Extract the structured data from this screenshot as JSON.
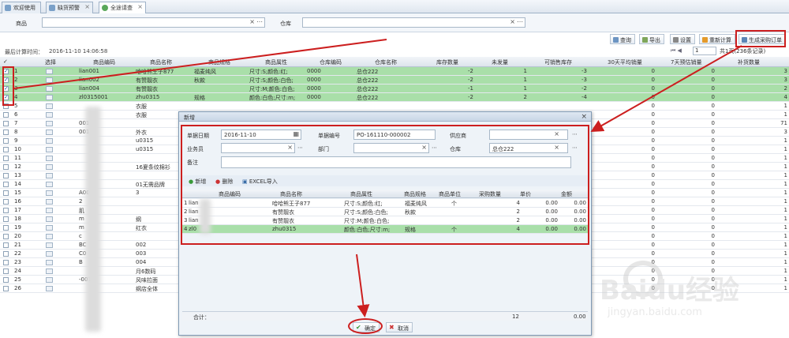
{
  "tabs": [
    {
      "label": "欢迎使用"
    },
    {
      "label": "缺货预警"
    },
    {
      "label": "全途请查"
    }
  ],
  "filter": {
    "product_label": "商品",
    "warehouse_label": "仓库"
  },
  "toolbar": {
    "query": "查询",
    "export": "导出",
    "settings": "设置",
    "refresh": "重新计算",
    "generate": "生成采购订单"
  },
  "calc_time": {
    "label": "最后计算时间：",
    "value": "2016-11-10 14:06:58"
  },
  "pagination": {
    "page": "1",
    "info": "共1页(236条记录)"
  },
  "columns": [
    "选择",
    "商品编码",
    "商品名称",
    "商品规格",
    "商品属性",
    "仓库编码",
    "仓库名称",
    "库存数量",
    "未发量",
    "可销售库存",
    "30天平均销量",
    "7天预估销量",
    "补货数量"
  ],
  "rows": [
    {
      "n": "1",
      "checked": true,
      "sel": true,
      "code": "lian001",
      "name": "哈哈熊王子877",
      "spec": "福麦纯风",
      "attr": "尺寸:S;颜色:红;",
      "whcode": "0000",
      "whname": "总仓222",
      "stock": "-2",
      "unsent": "1",
      "sale": "-3",
      "avg30": "0",
      "pred7": "0",
      "replenish": "3"
    },
    {
      "n": "2",
      "checked": true,
      "sel": true,
      "code": "lian002",
      "name": "有赞靓衣",
      "spec": "秋款",
      "attr": "尺寸:S;颜色:白色;",
      "whcode": "0000",
      "whname": "总仓222",
      "stock": "-2",
      "unsent": "1",
      "sale": "-3",
      "avg30": "0",
      "pred7": "0",
      "replenish": "3"
    },
    {
      "n": "3",
      "checked": true,
      "sel": true,
      "code": "lian004",
      "name": "有赞靓衣",
      "spec": "",
      "attr": "尺寸:M;颜色:白色;",
      "whcode": "0000",
      "whname": "总仓222",
      "stock": "-1",
      "unsent": "1",
      "sale": "-2",
      "avg30": "0",
      "pred7": "0",
      "replenish": "2"
    },
    {
      "n": "4",
      "checked": true,
      "sel": true,
      "code": "zl0315001",
      "name": "zhu0315",
      "spec": "规格",
      "attr": "颜色:白色;尺寸:m;",
      "whcode": "0000",
      "whname": "总仓222",
      "stock": "-2",
      "unsent": "2",
      "sale": "-4",
      "avg30": "0",
      "pred7": "0",
      "replenish": "4"
    },
    {
      "n": "5",
      "code": "",
      "name": "衣服",
      "replenish": "1"
    },
    {
      "n": "6",
      "code": "",
      "name": "衣服",
      "replenish": "1"
    },
    {
      "n": "7",
      "code": "001",
      "name": "",
      "replenish": "71"
    },
    {
      "n": "8",
      "code": "001",
      "name": "外衣",
      "replenish": "3"
    },
    {
      "n": "9",
      "code": "",
      "name": "u0315",
      "replenish": "1"
    },
    {
      "n": "10",
      "code": "",
      "name": "u0315",
      "replenish": "1"
    },
    {
      "n": "11",
      "code": "",
      "name": "",
      "replenish": "1"
    },
    {
      "n": "12",
      "code": "",
      "name": "16夏条纹棉衫",
      "replenish": "1"
    },
    {
      "n": "13",
      "code": "",
      "name": "",
      "replenish": "1"
    },
    {
      "n": "14",
      "code": "",
      "name": "01无需品牌",
      "replenish": "1"
    },
    {
      "n": "15",
      "code": "A001",
      "name": "3",
      "replenish": "1"
    },
    {
      "n": "16",
      "code": "2",
      "name": "",
      "replenish": "1"
    },
    {
      "n": "17",
      "code": "肌",
      "name": "",
      "replenish": "1"
    },
    {
      "n": "18",
      "code": "m",
      "name": "纲",
      "replenish": "1"
    },
    {
      "n": "19",
      "code": "m",
      "name": "红衣",
      "replenish": "1"
    },
    {
      "n": "20",
      "code": "c",
      "name": "",
      "replenish": "1"
    },
    {
      "n": "21",
      "code": "BC",
      "name": "002",
      "replenish": "1"
    },
    {
      "n": "22",
      "code": "C0",
      "name": "003",
      "replenish": "1"
    },
    {
      "n": "23",
      "code": "B",
      "name": "004",
      "replenish": "1"
    },
    {
      "n": "24",
      "code": "",
      "name": "月6数码",
      "replenish": "1"
    },
    {
      "n": "25",
      "code": "-001",
      "name": "风味拉面",
      "replenish": "1"
    },
    {
      "n": "26",
      "code": "",
      "name": "纲店全体",
      "replenish": "1"
    }
  ],
  "dialog": {
    "title": "新增",
    "form": {
      "date_label": "单据日期",
      "date_value": "2016-11-10",
      "no_label": "单据编号",
      "no_value": "PO-161110-000002",
      "supplier_label": "供应商",
      "supplier_value": "",
      "clerk_label": "业务员",
      "clerk_value": "",
      "dept_label": "部门",
      "dept_value": "",
      "wh_label": "仓库",
      "wh_value": "总仓222",
      "remark_label": "备注",
      "remark_value": ""
    },
    "actions": {
      "add": "新增",
      "delete": "删除",
      "import": "EXCEL导入"
    },
    "columns": [
      "商品编码",
      "商品名称",
      "商品属性",
      "商品规格",
      "商品单位",
      "采购数量",
      "单价",
      "金额"
    ],
    "rows": [
      {
        "n": "1",
        "code": "lian",
        "name": "哈哈熊王子877",
        "attr": "尺寸:S;颜色:红;",
        "spec": "福麦纯风",
        "unit": "个",
        "qty": "4",
        "price": "0.00",
        "amount": "0.00"
      },
      {
        "n": "2",
        "code": "lian",
        "name": "有赞靓衣",
        "attr": "尺寸:S;颜色:白色;",
        "spec": "秋款",
        "unit": "",
        "qty": "2",
        "price": "0.00",
        "amount": "0.00"
      },
      {
        "n": "3",
        "code": "lian",
        "name": "有赞靓衣",
        "attr": "尺寸:M;颜色:白色;",
        "spec": "",
        "unit": "",
        "qty": "2",
        "price": "0.00",
        "amount": "0.00"
      },
      {
        "n": "4",
        "code": "zl0",
        "name": "zhu0315",
        "attr": "颜色:白色;尺寸:m;",
        "spec": "规格",
        "unit": "个",
        "qty": "4",
        "price": "0.00",
        "amount": "0.00"
      }
    ],
    "total_label": "合计：",
    "total_qty": "12",
    "total_amount": "0.00",
    "confirm": "确定",
    "cancel": "取消"
  },
  "watermark": {
    "brand": "Baidu经验",
    "url": "jingyan.baidu.com"
  },
  "colors": {
    "selected_row": "#a9dfa9",
    "annotation": "#cc1f1f"
  }
}
